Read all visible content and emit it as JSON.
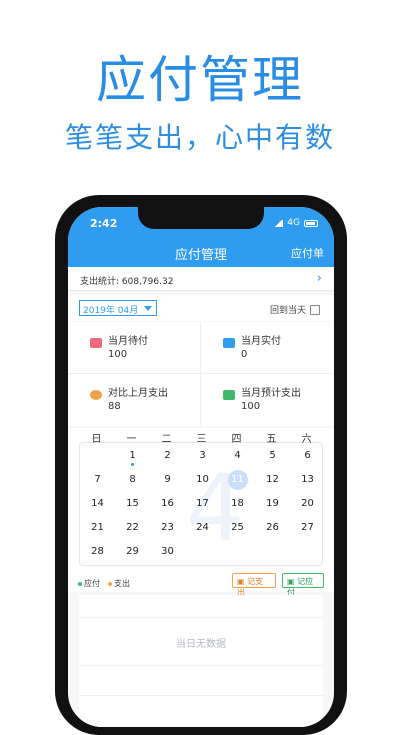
{
  "hero": {
    "title": "应付管理",
    "subtitle": "笔笔支出，心中有数"
  },
  "status_bar": {
    "time": "2:42",
    "network": "4G"
  },
  "nav": {
    "title": "应付管理",
    "right": "应付单"
  },
  "summary": {
    "text": "支出统计: 608,796.32",
    "chevron": "›"
  },
  "month": {
    "label": "2019年 04月",
    "today": "回到当天"
  },
  "cards": [
    {
      "label": "当月待付",
      "value": "100",
      "icon": "wallet-icon",
      "color": "#f06a7a"
    },
    {
      "label": "当月实付",
      "value": "0",
      "icon": "card-icon",
      "color": "#2f9cf0"
    },
    {
      "label": "对比上月支出",
      "value": "88",
      "icon": "money-bag-icon",
      "color": "#f2a14a"
    },
    {
      "label": "当月预计支出",
      "value": "100",
      "icon": "cash-icon",
      "color": "#3fb96b"
    }
  ],
  "calendar": {
    "weekdays": [
      "日",
      "一",
      "二",
      "三",
      "四",
      "五",
      "六"
    ],
    "big_month": "4",
    "weeks": [
      [
        "",
        "1",
        "2",
        "3",
        "4",
        "5",
        "6"
      ],
      [
        "7",
        "8",
        "9",
        "10",
        "11",
        "12",
        "13"
      ],
      [
        "14",
        "15",
        "16",
        "17",
        "18",
        "19",
        "20"
      ],
      [
        "21",
        "22",
        "23",
        "24",
        "25",
        "26",
        "27"
      ],
      [
        "28",
        "29",
        "30",
        "",
        "",
        "",
        ""
      ]
    ],
    "selected_day": "11",
    "marked_day": "1"
  },
  "legend": {
    "pay": "应付",
    "expense": "支出",
    "pay_color": "#3fb96b",
    "expense_color": "#f2a14a"
  },
  "buttons": {
    "add_expense": "记支出",
    "add_payable": "记应付"
  },
  "empty": {
    "text": "当日无数据"
  }
}
